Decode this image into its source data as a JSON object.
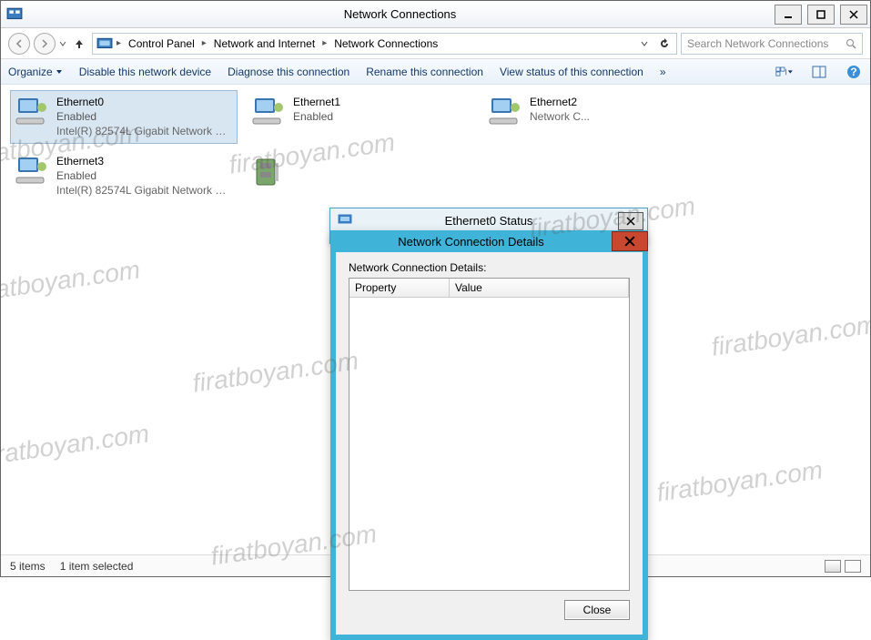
{
  "window": {
    "title": "Network Connections",
    "min_tooltip": "Minimize",
    "max_tooltip": "Maximize",
    "close_tooltip": "Close"
  },
  "breadcrumb": {
    "items": [
      "Control Panel",
      "Network and Internet",
      "Network Connections"
    ]
  },
  "search": {
    "placeholder": "Search Network Connections"
  },
  "toolbar": {
    "organize": "Organize",
    "disable": "Disable this network device",
    "diagnose": "Diagnose this connection",
    "rename": "Rename this connection",
    "viewstatus": "View status of this connection"
  },
  "connections": [
    {
      "name": "Ethernet0",
      "status": "Enabled",
      "device": "Intel(R) 82574L Gigabit Network C...",
      "selected": true
    },
    {
      "name": "Ethernet1",
      "status": "Enabled",
      "device": "",
      "selected": false
    },
    {
      "name": "Ethernet2",
      "status": "",
      "device": "Network C...",
      "selected": false
    },
    {
      "name": "Ethernet3",
      "status": "Enabled",
      "device": "Intel(R) 82574L Gigabit Network C...",
      "selected": false
    },
    {
      "name": "",
      "status": "",
      "device": "",
      "selected": false
    }
  ],
  "statusbar": {
    "count": "5 items",
    "selected": "1 item selected"
  },
  "status_dialog": {
    "title": "Ethernet0 Status"
  },
  "details_dialog": {
    "title": "Network Connection Details",
    "label": "Network Connection Details:",
    "col_property": "Property",
    "col_value": "Value",
    "close_btn": "Close"
  },
  "watermark": "firatboyan.com"
}
